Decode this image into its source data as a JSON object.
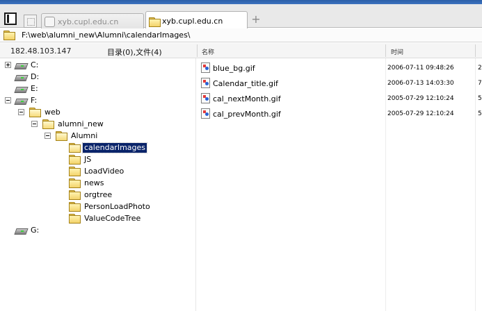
{
  "tabs": [
    {
      "label": "xyb.cupl.edu.cn",
      "active": false
    },
    {
      "label": "xyb.cupl.edu.cn",
      "active": true
    }
  ],
  "new_tab_symbol": "+",
  "address": {
    "path": "F:\\web\\alumni_new\\Alumni\\calendarImages\\"
  },
  "header": {
    "ip": "182.48.103.147",
    "count": "目录(0),文件(4)",
    "col_name": "名称",
    "col_time": "时间"
  },
  "tree": {
    "drives": [
      {
        "label": "C:",
        "expander": "plus"
      },
      {
        "label": "D:",
        "expander": "none"
      },
      {
        "label": "E:",
        "expander": "none"
      },
      {
        "label": "F:",
        "expander": "minus"
      },
      {
        "label": "G:",
        "expander": "none"
      }
    ],
    "folders": [
      {
        "label": "web"
      },
      {
        "label": "alumni_new"
      },
      {
        "label": "Alumni"
      },
      {
        "label": "calendarImages",
        "selected": true
      },
      {
        "label": "JS"
      },
      {
        "label": "LoadVideo"
      },
      {
        "label": "news"
      },
      {
        "label": "orgtree"
      },
      {
        "label": "PersonLoadPhoto"
      },
      {
        "label": "ValueCodeTree"
      }
    ]
  },
  "files": [
    {
      "name": "blue_bg.gif",
      "time": "2006-07-11 09:48:26",
      "extra": "2"
    },
    {
      "name": "Calendar_title.gif",
      "time": "2006-07-13 14:03:30",
      "extra": "7"
    },
    {
      "name": "cal_nextMonth.gif",
      "time": "2005-07-29 12:10:24",
      "extra": "5"
    },
    {
      "name": "cal_prevMonth.gif",
      "time": "2005-07-29 12:10:24",
      "extra": "5"
    }
  ],
  "colors": {
    "titlebar": "#2b5fa8",
    "selection": "#0a246a",
    "folder": "#f3d36a"
  },
  "icons": {
    "drive": "drive-icon",
    "folder": "folder-icon",
    "file": "gif-file-icon"
  }
}
